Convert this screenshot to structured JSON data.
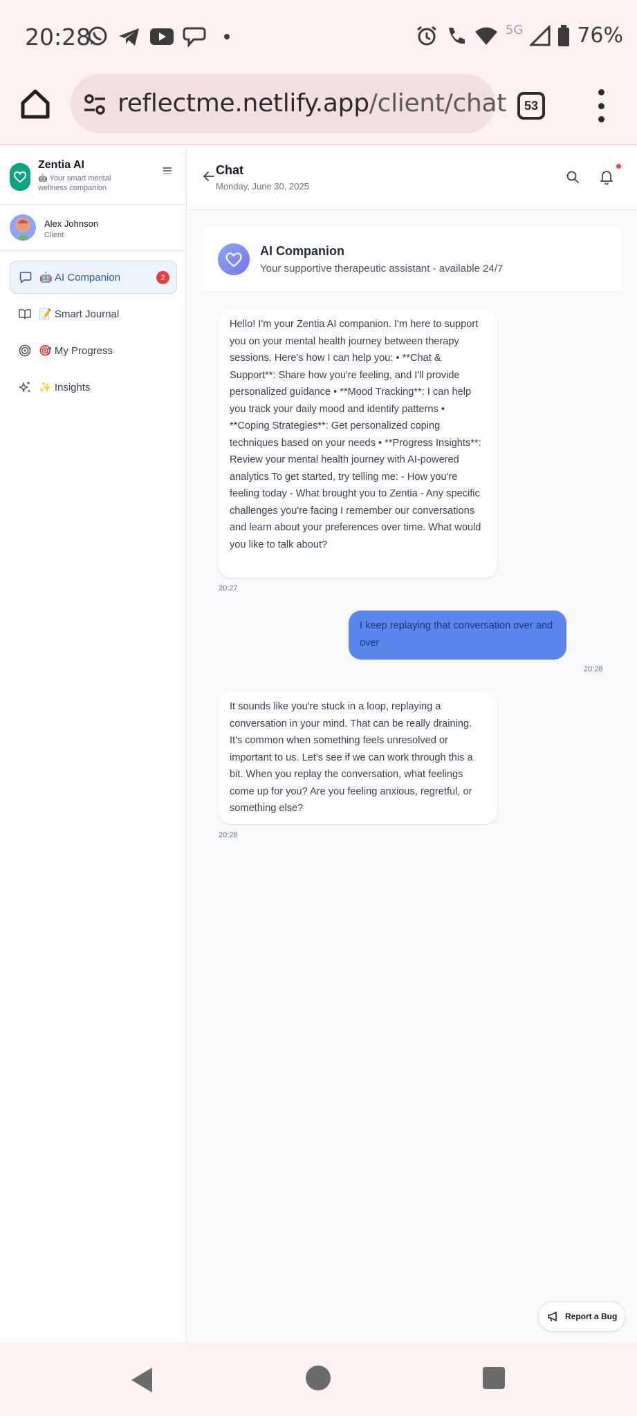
{
  "status_bar": {
    "time": "20:28",
    "network_label": "5G",
    "battery": "76%"
  },
  "browser": {
    "url_host": "reflectme.netlify.app",
    "url_path": "/client/chat",
    "tab_count": "53"
  },
  "sidebar": {
    "brand_title": "Zentia AI",
    "brand_subtitle": "🤖 Your smart mental wellness companion",
    "user_name": "Alex Johnson",
    "user_role": "Client",
    "items": [
      {
        "label": "🤖 AI Companion",
        "badge": "2",
        "icon": "message-icon",
        "active": true
      },
      {
        "label": "📝 Smart Journal",
        "icon": "book-icon"
      },
      {
        "label": "🎯 My Progress",
        "icon": "target-icon"
      },
      {
        "label": "✨ Insights",
        "icon": "sparkles-icon"
      }
    ]
  },
  "header": {
    "title": "Chat",
    "date": "Monday, June 30, 2025"
  },
  "companion": {
    "name": "AI Companion",
    "subtitle": "Your supportive therapeutic assistant - available 24/7"
  },
  "messages": [
    {
      "role": "ai",
      "text": "Hello! I'm your Zentia AI companion. I'm here to support you on your mental health journey between therapy sessions. Here's how I can help you: • **Chat & Support**: Share how you're feeling, and I'll provide personalized guidance • **Mood Tracking**: I can help you track your daily mood and identify patterns • **Coping Strategies**: Get personalized coping techniques based on your needs • **Progress Insights**: Review your mental health journey with AI-powered analytics To get started, try telling me: - How you're feeling today - What brought you to Zentia - Any specific challenges you're facing I remember our conversations and learn about your preferences over time. What would you like to talk about?",
      "time": "20:27"
    },
    {
      "role": "user",
      "text": "I keep replaying that conversation over and over",
      "time": "20:28"
    },
    {
      "role": "ai",
      "text": "It sounds like you're stuck in a loop, replaying a conversation in your mind. That can be really draining. It's common when something feels unresolved or important to us. Let's see if we can work through this a bit. When you replay the conversation, what feelings come up for you? Are you feeling anxious, regretful, or something else?",
      "time": "20:28"
    }
  ],
  "report_bug_label": "Report a Bug",
  "colors": {
    "brand_green": "#10a37f",
    "user_bubble": "#5b86eb",
    "active_nav_bg": "#eef4fd",
    "badge_red": "#e53e3e"
  }
}
